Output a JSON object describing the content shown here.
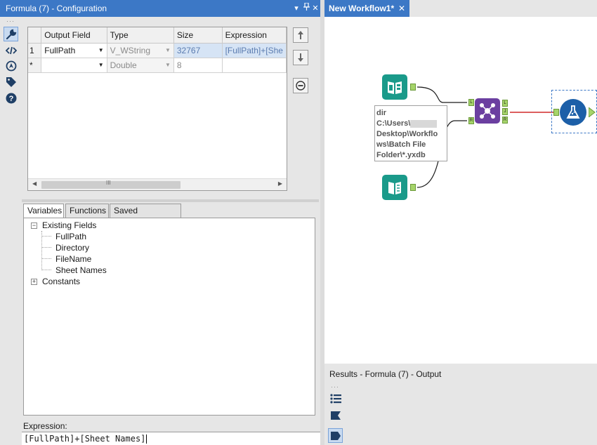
{
  "config": {
    "title": "Formula (7) - Configuration",
    "title_buttons": [
      "▾",
      "📌",
      "✕"
    ],
    "grid": {
      "headers": [
        "",
        "Output Field",
        "Type",
        "Size",
        "Expression"
      ],
      "rows": [
        {
          "num": "1",
          "field": "FullPath",
          "type": "V_WString",
          "size": "32767",
          "expression": "[FullPath]+[She"
        },
        {
          "num": "*",
          "field": "",
          "type": "Double",
          "size": "8",
          "expression": ""
        }
      ],
      "scroll_thumb": "III"
    },
    "tabs": [
      "Variables",
      "Functions",
      "Saved Expressions"
    ],
    "tree": {
      "existing_fields_label": "Existing Fields",
      "fields": [
        "FullPath",
        "Directory",
        "FileName",
        "Sheet Names"
      ],
      "constants_label": "Constants"
    },
    "expression_label": "Expression:",
    "expression_value": "[FullPath]+[Sheet Names]"
  },
  "workflow": {
    "tab_title": "New Workflow1*",
    "annotation_lines": [
      "dir",
      "C:\\Users\\",
      "Desktop\\Workflo",
      "ws\\Batch File",
      "Folder\\*.yxdb"
    ],
    "join_anchors": {
      "left_in": "L",
      "right_in": "R",
      "out_l": "L",
      "out_j": "J",
      "out_r": "R"
    }
  },
  "results": {
    "title": "Results - Formula (7) - Output"
  },
  "colors": {
    "titlebar": "#3c78c6",
    "input_tool": "#1a9a8a",
    "join_tool": "#6b3fa0",
    "formula_tool": "#1c5fa8",
    "connection_red": "#d12a2a",
    "anchor_green": "#a6d46a"
  }
}
